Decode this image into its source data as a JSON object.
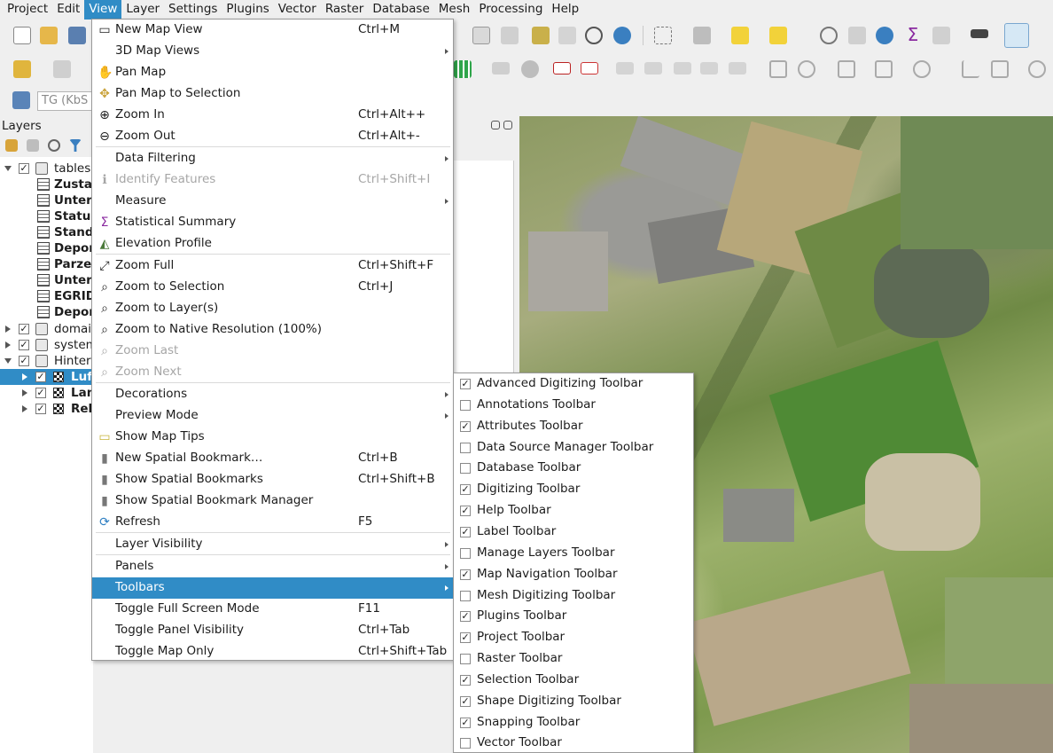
{
  "menubar": {
    "items": [
      "Project",
      "Edit",
      "View",
      "Layer",
      "Settings",
      "Plugins",
      "Vector",
      "Raster",
      "Database",
      "Mesh",
      "Processing",
      "Help"
    ],
    "active": "View"
  },
  "toolbar": {
    "crs_field": "TG (KbS"
  },
  "layers_panel": {
    "title": "Layers",
    "tree": [
      {
        "label": "tables",
        "checked": "✓"
      },
      {
        "label": "Zustae"
      },
      {
        "label": "Unters"
      },
      {
        "label": "Status"
      },
      {
        "label": "Stando"
      },
      {
        "label": "Depon"
      },
      {
        "label": "Parzel"
      },
      {
        "label": "Unters"
      },
      {
        "label": "EGRID"
      },
      {
        "label": "Depon"
      },
      {
        "label": "domai",
        "checked": "✓"
      },
      {
        "label": "system",
        "checked": "✓"
      },
      {
        "label": "Hinter",
        "checked": "✓"
      },
      {
        "label": "Luf",
        "checked": "✓"
      },
      {
        "label": "Lan",
        "checked": "✓"
      },
      {
        "label": "Rel",
        "checked": "✓"
      }
    ]
  },
  "view_menu": {
    "items": [
      {
        "label": "New Map View",
        "shortcut": "Ctrl+M",
        "icon": "new-map-view-icon",
        "glyph": "▭"
      },
      {
        "label": "3D Map Views",
        "shortcut": "",
        "icon": "",
        "glyph": ""
      },
      {
        "label": "Pan Map",
        "shortcut": "",
        "icon": "pan-hand-icon",
        "glyph": "✋"
      },
      {
        "label": "Pan Map to Selection",
        "shortcut": "",
        "icon": "pan-selection-icon",
        "glyph": "✥"
      },
      {
        "label": "Zoom In",
        "shortcut": "Ctrl+Alt++",
        "icon": "zoom-in-icon",
        "glyph": "⊕"
      },
      {
        "label": "Zoom Out",
        "shortcut": "Ctrl+Alt+-",
        "icon": "zoom-out-icon",
        "glyph": "⊖"
      },
      {
        "label": "Data Filtering",
        "shortcut": "",
        "icon": "",
        "glyph": ""
      },
      {
        "label": "Identify Features",
        "shortcut": "Ctrl+Shift+I",
        "icon": "identify-icon",
        "glyph": "ℹ"
      },
      {
        "label": "Measure",
        "shortcut": "",
        "icon": "",
        "glyph": ""
      },
      {
        "label": "Statistical Summary",
        "shortcut": "",
        "icon": "sigma-icon",
        "glyph": "Σ"
      },
      {
        "label": "Elevation Profile",
        "shortcut": "",
        "icon": "elevation-profile-icon",
        "glyph": "◭"
      },
      {
        "label": "Zoom Full",
        "shortcut": "Ctrl+Shift+F",
        "icon": "zoom-full-icon",
        "glyph": "⤢"
      },
      {
        "label": "Zoom to Selection",
        "shortcut": "Ctrl+J",
        "icon": "zoom-selection-icon",
        "glyph": "⌕"
      },
      {
        "label": "Zoom to Layer(s)",
        "shortcut": "",
        "icon": "zoom-layer-icon",
        "glyph": "⌕"
      },
      {
        "label": "Zoom to Native Resolution (100%)",
        "shortcut": "",
        "icon": "zoom-native-icon",
        "glyph": "⌕"
      },
      {
        "label": "Zoom Last",
        "shortcut": "",
        "icon": "zoom-last-icon",
        "glyph": "⌕"
      },
      {
        "label": "Zoom Next",
        "shortcut": "",
        "icon": "zoom-next-icon",
        "glyph": "⌕"
      },
      {
        "label": "Decorations",
        "shortcut": "",
        "icon": "",
        "glyph": ""
      },
      {
        "label": "Preview Mode",
        "shortcut": "",
        "icon": "",
        "glyph": ""
      },
      {
        "label": "Show Map Tips",
        "shortcut": "",
        "icon": "map-tips-icon",
        "glyph": "▭"
      },
      {
        "label": "New Spatial Bookmark…",
        "shortcut": "Ctrl+B",
        "icon": "new-bookmark-icon",
        "glyph": "▮"
      },
      {
        "label": "Show Spatial Bookmarks",
        "shortcut": "Ctrl+Shift+B",
        "icon": "bookmarks-icon",
        "glyph": "▮"
      },
      {
        "label": "Show Spatial Bookmark Manager",
        "shortcut": "",
        "icon": "bookmark-manager-icon",
        "glyph": "▮"
      },
      {
        "label": "Refresh",
        "shortcut": "F5",
        "icon": "refresh-icon",
        "glyph": "⟳"
      },
      {
        "label": "Layer Visibility",
        "shortcut": "",
        "icon": "",
        "glyph": ""
      },
      {
        "label": "Panels",
        "shortcut": "",
        "icon": "",
        "glyph": ""
      },
      {
        "label": "Toolbars",
        "shortcut": "",
        "icon": "",
        "glyph": ""
      },
      {
        "label": "Toggle Full Screen Mode",
        "shortcut": "F11",
        "icon": "",
        "glyph": ""
      },
      {
        "label": "Toggle Panel Visibility",
        "shortcut": "Ctrl+Tab",
        "icon": "",
        "glyph": ""
      },
      {
        "label": "Toggle Map Only",
        "shortcut": "Ctrl+Shift+Tab",
        "icon": "",
        "glyph": ""
      }
    ]
  },
  "toolbars_menu": {
    "items": [
      {
        "label": "Advanced Digitizing Toolbar",
        "check": "✓"
      },
      {
        "label": "Annotations Toolbar",
        "check": ""
      },
      {
        "label": "Attributes Toolbar",
        "check": "✓"
      },
      {
        "label": "Data Source Manager Toolbar",
        "check": ""
      },
      {
        "label": "Database Toolbar",
        "check": ""
      },
      {
        "label": "Digitizing Toolbar",
        "check": "✓"
      },
      {
        "label": "Help Toolbar",
        "check": "✓"
      },
      {
        "label": "Label Toolbar",
        "check": "✓"
      },
      {
        "label": "Manage Layers Toolbar",
        "check": ""
      },
      {
        "label": "Map Navigation Toolbar",
        "check": "✓"
      },
      {
        "label": "Mesh Digitizing Toolbar",
        "check": ""
      },
      {
        "label": "Plugins Toolbar",
        "check": "✓"
      },
      {
        "label": "Project Toolbar",
        "check": "✓"
      },
      {
        "label": "Raster Toolbar",
        "check": ""
      },
      {
        "label": "Selection Toolbar",
        "check": "✓"
      },
      {
        "label": "Shape Digitizing Toolbar",
        "check": "✓"
      },
      {
        "label": "Snapping Toolbar",
        "check": "✓"
      },
      {
        "label": "Vector Toolbar",
        "check": ""
      }
    ]
  },
  "colors": {
    "highlight": "#308cc6",
    "menu_bg": "#ffffff",
    "window_bg": "#efefef"
  }
}
